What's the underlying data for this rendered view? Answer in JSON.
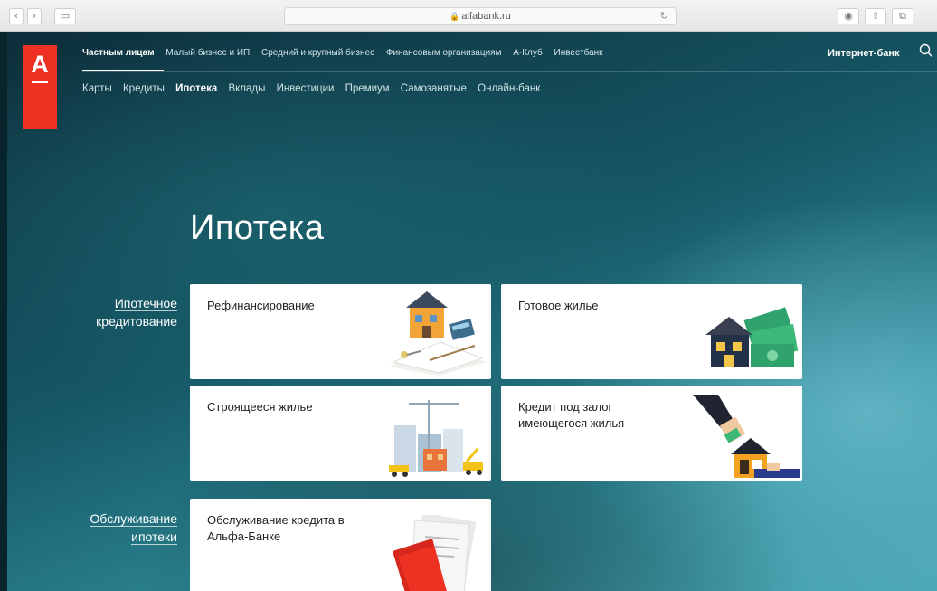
{
  "browser": {
    "back_label": "‹",
    "forward_label": "›",
    "sidebar_label": "▭",
    "url": "alfabank.ru",
    "reload_label": "↻",
    "right_buttons": [
      "◉",
      "⇧",
      "⧉"
    ]
  },
  "site": {
    "logo_letter": "А",
    "top_nav": [
      "Частным лицам",
      "Малый бизнес и ИП",
      "Средний и крупный бизнес",
      "Финансовым организациям",
      "А-Клуб",
      "Инвестбанк"
    ],
    "internet_bank": "Интернет-банк",
    "sub_nav": [
      "Карты",
      "Кредиты",
      "Ипотека",
      "Вклады",
      "Инвестиции",
      "Премиум",
      "Самозанятые",
      "Онлайн-банк"
    ],
    "page_title": "Ипотека",
    "section_mortgage": "Ипотечное\nкредитование",
    "section_service": "Обслуживание\nипотеки",
    "cards": {
      "refinance": "Рефинансирование",
      "ready": "Готовое жилье",
      "building": "Строящееся жилье",
      "pledge": "Кредит под залог\nимеющегося жилья",
      "service": "Обслуживание кредита в\nАльфа-Банке"
    }
  },
  "colors": {
    "brand_red": "#ef3124"
  }
}
